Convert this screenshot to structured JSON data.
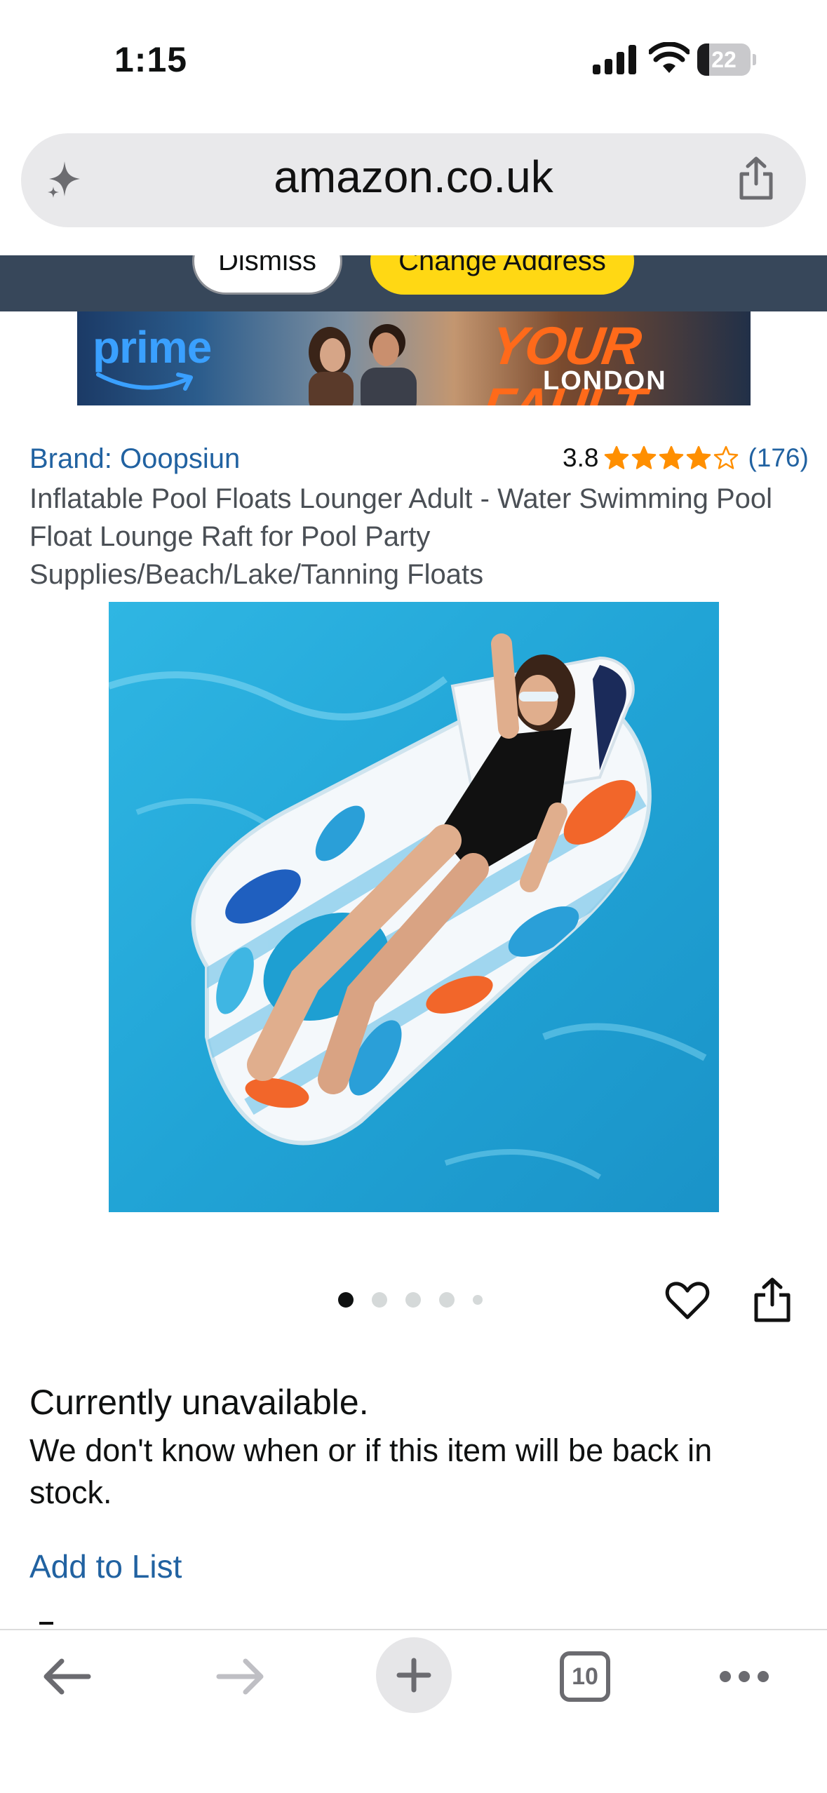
{
  "status_bar": {
    "time": "1:15",
    "battery_level": "22",
    "battery_fraction": 0.22
  },
  "browser": {
    "url": "amazon.co.uk",
    "open_tabs": "10"
  },
  "notice_bar": {
    "dismiss_label": "Dismiss",
    "change_address_label": "Change Address"
  },
  "ad": {
    "brand": "prime",
    "title": "YOUR FAULT",
    "subtitle": "LONDON"
  },
  "product": {
    "brand": "Brand: Ooopsiun",
    "rating_value": "3.8",
    "rating_stars": 3.8,
    "rating_count": "(176)",
    "title": "Inflatable Pool Floats Lounger Adult - Water Swimming Pool Float Lounge Raft for Pool Party Supplies/Beach/Lake/Tanning Floats",
    "image_count": 5,
    "active_image": 1
  },
  "availability": {
    "heading": "Currently unavailable.",
    "message": "We don't know when or if this item will be back in stock.",
    "add_to_list": "Add to List"
  },
  "icons": {
    "sparkle": "sparkle-icon",
    "share": "share-icon",
    "heart": "heart-icon",
    "back": "back-arrow-icon",
    "forward": "forward-arrow-icon",
    "new_tab": "plus-icon",
    "more": "ellipsis-icon"
  },
  "colors": {
    "link": "#2162a1",
    "banner_bg": "#37475a",
    "change_address_bg": "#ffd814",
    "star": "#ff8f00"
  }
}
